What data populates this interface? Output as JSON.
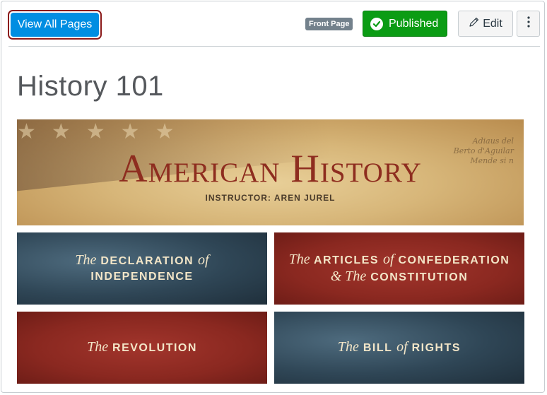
{
  "toolbar": {
    "view_all_label": "View All Pages",
    "front_page_badge": "Front Page",
    "published_label": "Published",
    "edit_label": "Edit",
    "more_icon": "kebab-icon"
  },
  "page": {
    "title": "History 101"
  },
  "banner": {
    "headline": "American History",
    "instructor": "INSTRUCTOR: AREN JUREL",
    "script_line1": "Adiaus del",
    "script_line2": "Berto d'Aguilar",
    "script_line3": "Mende si n"
  },
  "tiles": [
    {
      "pre": "The",
      "main": "DECLARATION",
      "mid": "of",
      "end": "INDEPENDENCE"
    },
    {
      "pre": "The",
      "main": "ARTICLES",
      "mid": "of",
      "end": "CONFEDERATION",
      "line2_pre": "& The",
      "line2": "CONSTITUTION"
    },
    {
      "pre": "The",
      "main": "REVOLUTION"
    },
    {
      "pre": "The",
      "main": "BILL",
      "mid": "of",
      "end": "RIGHTS"
    }
  ],
  "colors": {
    "primary": "#008ee2",
    "success": "#0b9c14",
    "badge": "#73818c",
    "tile_red": "#8a2820",
    "tile_blue": "#2f4656"
  }
}
